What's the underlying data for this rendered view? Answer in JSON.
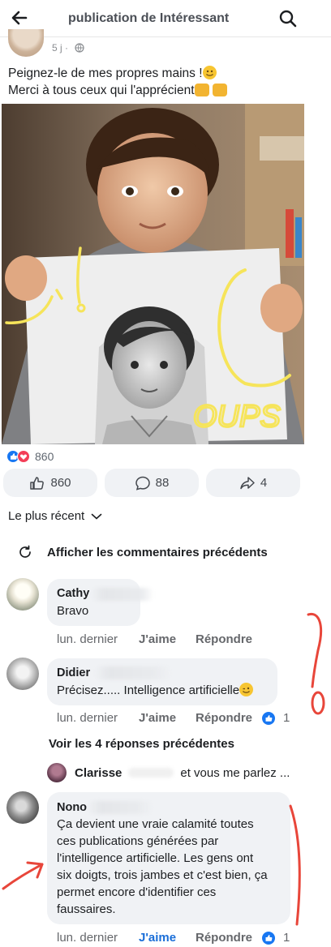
{
  "header": {
    "title": "publication de Intéressant"
  },
  "post": {
    "time": "5 j",
    "separator": "·",
    "text_line1": "Peignez-le de mes propres mains !",
    "text_line2": "Merci à tous ceux qui l'apprécient",
    "image_annotation": "OUPS",
    "reaction_count": "860"
  },
  "actions": {
    "like_count": "860",
    "comment_count": "88",
    "share_count": "4"
  },
  "comments_header": {
    "sort_label": "Le plus récent",
    "previous_label": "Afficher les commentaires précédents"
  },
  "comments": [
    {
      "name": "Cathy",
      "text": "Bravo",
      "time": "lun. dernier",
      "like_label": "J'aime",
      "reply_label": "Répondre"
    },
    {
      "name": "Didier",
      "text": "Précisez..... Intelligence artificielle",
      "time": "lun. dernier",
      "like_label": "J'aime",
      "reply_label": "Répondre",
      "likes": "1"
    },
    {
      "name": "Nono",
      "text_lines": [
        "Ça devient une vraie calamité toutes",
        "ces publications générées par",
        "l'intelligence artificielle. Les gens ont",
        "six doigts, trois jambes et c'est bien, ça",
        "permet encore d'identifier ces",
        "faussaires."
      ],
      "time": "lun. dernier",
      "like_label": "J'aime",
      "reply_label": "Répondre",
      "likes": "1"
    }
  ],
  "replies": {
    "see_previous": "Voir les 4 réponses précédentes",
    "preview_name": "Clarisse",
    "preview_text": "et vous me parlez ..."
  },
  "colors": {
    "accent_blue": "#1877f2",
    "bubble_gray": "#f0f2f5",
    "annotation_yellow": "#f6e45a",
    "annotation_red": "#e8463a"
  },
  "icons": [
    "back-arrow-icon",
    "search-icon",
    "globe-icon",
    "like-icon",
    "love-icon",
    "comment-icon",
    "share-icon",
    "chevron-down-icon",
    "refresh-icon"
  ]
}
